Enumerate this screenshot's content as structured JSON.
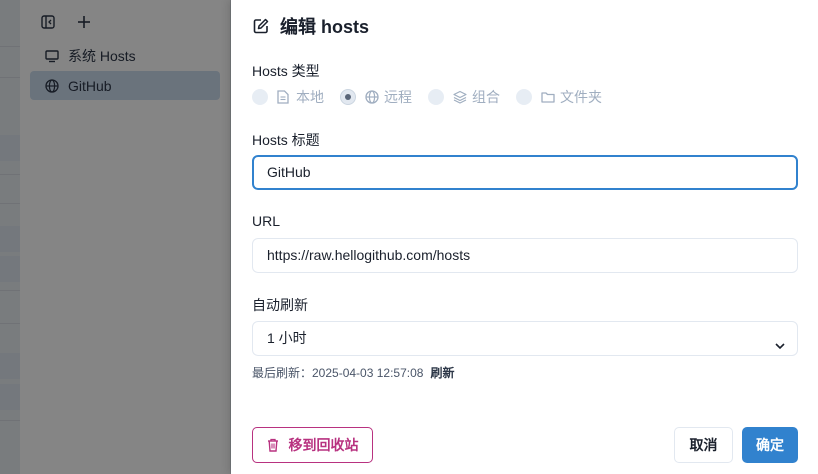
{
  "sidebar": {
    "toolbar": {
      "toggle_icon": "sidebar-toggle-icon",
      "add_icon": "plus-icon"
    },
    "items": [
      {
        "label": "系统 Hosts",
        "icon": "monitor-icon",
        "active": false
      },
      {
        "label": "GitHub",
        "icon": "globe-icon",
        "active": true
      }
    ]
  },
  "drawer": {
    "title": "编辑 hosts",
    "title_icon": "edit-icon",
    "hosts_type": {
      "label": "Hosts 类型",
      "options": [
        {
          "label": "本地",
          "icon": "file-icon",
          "checked": false
        },
        {
          "label": "远程",
          "icon": "globe-icon",
          "checked": true
        },
        {
          "label": "组合",
          "icon": "layers-icon",
          "checked": false
        },
        {
          "label": "文件夹",
          "icon": "folder-icon",
          "checked": false
        }
      ]
    },
    "hosts_title": {
      "label": "Hosts 标题",
      "value": "GitHub"
    },
    "url": {
      "label": "URL",
      "value": "https://raw.hellogithub.com/hosts"
    },
    "auto_refresh": {
      "label": "自动刷新",
      "selected": "1 小时"
    },
    "last_refresh": {
      "text": "最后刷新：2025-04-03 12:57:08",
      "action": "刷新"
    },
    "buttons": {
      "trash": "移到回收站",
      "cancel": "取消",
      "ok": "确定"
    },
    "colors": {
      "accent": "#3182ce",
      "danger": "#b83280"
    }
  }
}
